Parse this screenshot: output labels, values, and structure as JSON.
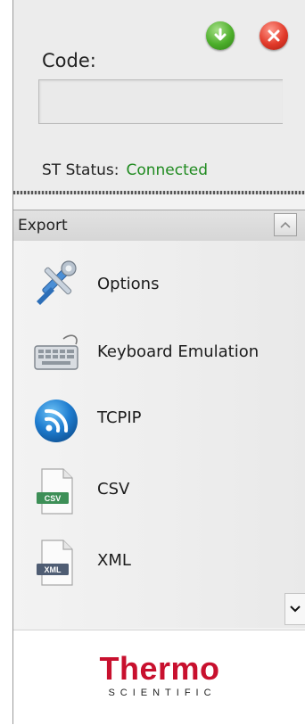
{
  "header": {
    "code_label": "Code:",
    "code_value": "",
    "status_label": "ST Status:",
    "status_value": "Connected",
    "status_color": "#1f8a1f",
    "download_icon": "download-arrow-icon",
    "close_icon": "close-x-icon"
  },
  "export": {
    "title": "Export",
    "collapse_icon": "chevron-up-icon",
    "items": [
      {
        "label": "Options",
        "icon": "wrench-screwdriver-icon"
      },
      {
        "label": "Keyboard Emulation",
        "icon": "keyboard-icon"
      },
      {
        "label": "TCPIP",
        "icon": "rss-feed-icon"
      },
      {
        "label": "CSV",
        "icon": "csv-file-icon",
        "badge": "CSV"
      },
      {
        "label": "XML",
        "icon": "xml-file-icon",
        "badge": "XML"
      }
    ],
    "scroll_icon": "chevron-down-icon"
  },
  "footer": {
    "brand": "Thermo",
    "brand_sub": "SCIENTIFIC",
    "brand_color": "#c8102e"
  }
}
